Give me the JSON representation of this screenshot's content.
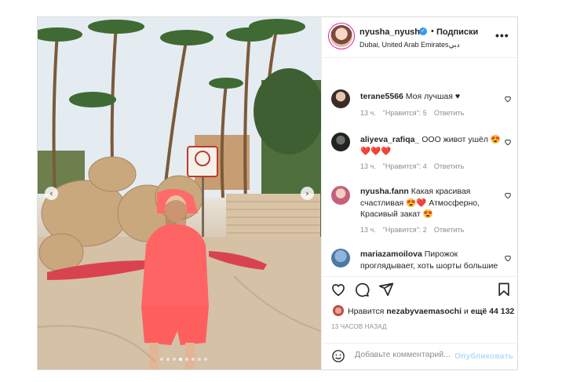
{
  "post": {
    "header": {
      "username": "nyusha_nyusha",
      "separator": "•",
      "follow_label": "Подписки",
      "location": "Dubai, United Arab Emirates",
      "location_suffix": "دبي"
    },
    "photo": {
      "sign_text": "",
      "carousel_total": 8,
      "carousel_active": 3
    },
    "comments": [
      {
        "username": "terane5566",
        "text": "Моя лучшая ♥",
        "time": "13 ч.",
        "likes": "\"Нравится\": 5",
        "reply": "Ответить"
      },
      {
        "username": "aliyeva_rafiqa_",
        "text": "ООО живот ушёл 😍❤️❤️❤️",
        "time": "13 ч.",
        "likes": "\"Нравится\": 4",
        "reply": "Ответить"
      },
      {
        "username": "nyusha.fann",
        "text": "Какая красивая счастливая 😍❤️ Атмосферно, Красивый закат 😍",
        "time": "13 ч.",
        "likes": "\"Нравится\": 2",
        "reply": "Ответить"
      },
      {
        "username": "mariazamoilova",
        "text": "Пирожок проглядывает, хоть шорты большие",
        "time": "",
        "likes": "",
        "reply": ""
      }
    ],
    "likes": {
      "prefix": "Нравится",
      "user": "nezabyvaemasochi",
      "middle": "и",
      "others": "ещё 44 132"
    },
    "time_ago": "13 ЧАСОВ НАЗАД",
    "add_comment": {
      "placeholder": "Добавьте комментарий...",
      "publish_label": "Опубликовать"
    },
    "colors": {
      "verified": "#3897f0",
      "publish_disabled": "#b2dffc",
      "hoodie": "#ff6b6b"
    }
  }
}
